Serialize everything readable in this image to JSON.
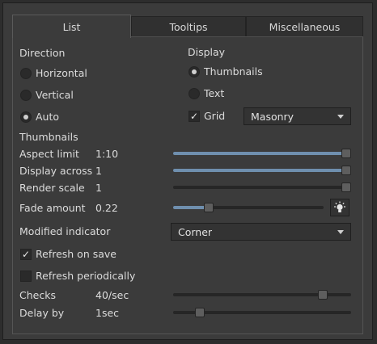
{
  "tabs": [
    {
      "label": "List",
      "active": true
    },
    {
      "label": "Tooltips",
      "active": false
    },
    {
      "label": "Miscellaneous",
      "active": false
    }
  ],
  "direction": {
    "title": "Direction",
    "options": [
      {
        "label": "Horizontal",
        "checked": false
      },
      {
        "label": "Vertical",
        "checked": false
      },
      {
        "label": "Auto",
        "checked": true
      }
    ]
  },
  "display": {
    "title": "Display",
    "options": [
      {
        "label": "Thumbnails",
        "checked": true
      },
      {
        "label": "Text",
        "checked": false
      }
    ],
    "grid": {
      "label": "Grid",
      "checked": true,
      "checkmark": "✓"
    },
    "grid_mode": "Masonry"
  },
  "thumbnails": {
    "title": "Thumbnails",
    "rows": [
      {
        "label": "Aspect limit",
        "value": "1:10",
        "level": 1.0
      },
      {
        "label": "Display across",
        "value": "1",
        "level": 1.0
      },
      {
        "label": "Render scale",
        "value": "1",
        "level": 1.0
      },
      {
        "label": "Fade amount",
        "value": "0.22",
        "level": 0.22
      }
    ],
    "fade_icon": "bulb-icon"
  },
  "modified_indicator": {
    "label": "Modified indicator",
    "value": "Corner"
  },
  "refresh_on_save": {
    "label": "Refresh on save",
    "checked": true,
    "checkmark": "✓"
  },
  "refresh_periodically": {
    "label": "Refresh periodically",
    "checked": false
  },
  "checks": {
    "label": "Checks",
    "value": "40/sec",
    "level": 0.86
  },
  "delay": {
    "label": "Delay by",
    "value": "1sec",
    "level": 0.13
  },
  "colors": {
    "accent": "#6f8fae",
    "background": "#3b3b3b",
    "text": "#dcdcdc"
  }
}
